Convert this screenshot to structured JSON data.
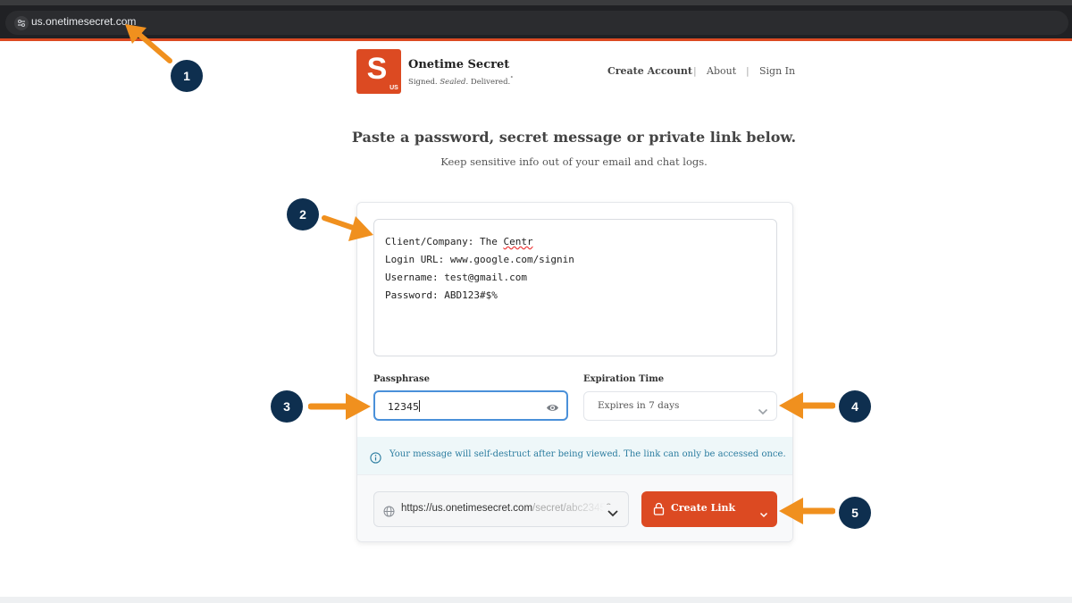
{
  "browser": {
    "url": "us.onetimesecret.com"
  },
  "brand": {
    "logo_letter": "S",
    "logo_badge": "US",
    "name": "Onetime Secret",
    "tagline_plain1": "Signed. ",
    "tagline_italic": "Sealed.",
    "tagline_plain2": " Delivered.",
    "tagline_mark": "°",
    "color": "#dc4a22"
  },
  "nav": {
    "create_account": "Create Account",
    "about": "About",
    "sign_in": "Sign In",
    "separator": "|"
  },
  "hero": {
    "headline": "Paste a password, secret message or private link below.",
    "subhead": "Keep sensitive info out of your email and chat logs."
  },
  "form": {
    "secret_line1_prefix": "Client/Company: The ",
    "secret_line1_misspelled": "Centr",
    "secret_line2": "Login URL: www.google.com/signin",
    "secret_line3": "Username: test@gmail.com",
    "secret_line4": "Password: ABD123#$%",
    "passphrase_label": "Passphrase",
    "passphrase_value": "12345",
    "expiration_label": "Expiration Time",
    "expiration_value": "Expires in 7 days",
    "notice": "Your message will self-destruct after being viewed. The link can only be accessed once.",
    "domain_prefix": "https://",
    "domain_host": "us.onetimesecret.com",
    "domain_path": "/secret/abc23456",
    "create_button": "Create Link"
  },
  "annotations": [
    "1",
    "2",
    "3",
    "4",
    "5"
  ],
  "colors": {
    "accent": "#dc4a22",
    "focus": "#4a90d9",
    "notice_text": "#2c7da0",
    "annotation_badge": "#0e2f4f",
    "annotation_arrow": "#f0901e"
  },
  "icons": [
    "tune-icon",
    "eye-icon",
    "chevron-down-icon",
    "info-icon",
    "globe-icon",
    "lock-icon"
  ]
}
